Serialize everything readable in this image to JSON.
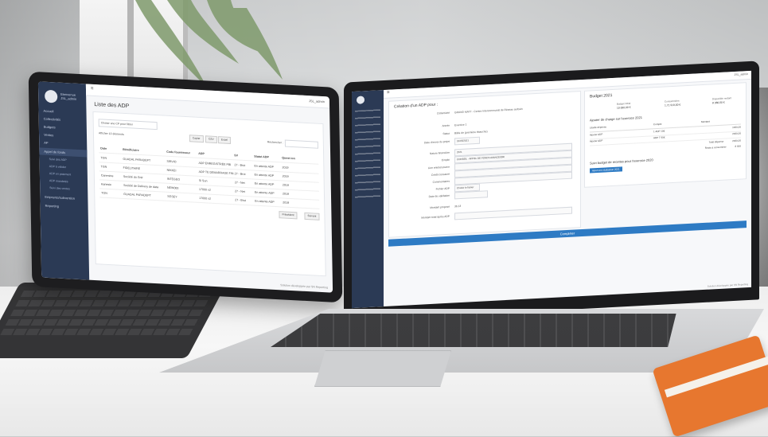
{
  "tablet": {
    "sidebar": {
      "user": "Bienvenue\nJSL_admin",
      "items": [
        "Accueil",
        "Collectivités",
        "Budgets",
        "Ventes",
        "AP",
        "Appel de fonds",
        "Suivi des ADP",
        "ADP à valider",
        "ADP en paiement",
        "ADP mandatés",
        "Suivi des ventes",
        "Emprunts/subvention",
        "Reporting"
      ]
    },
    "user_menu": "JSL_admin",
    "page_title": "Liste des ADP",
    "filter_placeholder": "Choisir une CP pour filtrer",
    "export_buttons": [
      "Copier",
      "CSV",
      "Excel"
    ],
    "search_label": "Rechercher :",
    "show_entries": "Afficher 10 éléments",
    "columns": [
      "Date",
      "Bénéficiaire",
      "Code fournisseur",
      "ADP",
      "SV",
      "Statut ADP",
      "Quest ion"
    ],
    "rows": [
      [
        "TGN",
        "GUADAL PARADEPT",
        "SIRVIO",
        "ADP ENREGISTRÉE PBI",
        "27 - Brut",
        "En attente ADP",
        "2019"
      ],
      [
        "TGN",
        "FIDELITAIRE",
        "NIKKEI",
        "ADP TE DEMARRAGE FIN",
        "27 - Brut",
        "En attente ADP",
        "2019"
      ],
      [
        "Caremine",
        "Société du Gnir",
        "INTEGEO",
        "Si Sun",
        "27 - Net",
        "En attente ADP",
        "2019"
      ],
      [
        "Kanesie",
        "Société de Delivery de data",
        "NEW000",
        "17000 x2",
        "27 - Net",
        "En attente ADP",
        "2019"
      ],
      [
        "TGN",
        "GUADAL PARADEPT",
        "SGSEY",
        "17000 x2",
        "27 - Brut",
        "En attente ADP",
        "2019"
      ]
    ],
    "pagination": [
      "Précédent",
      "Suivant"
    ],
    "footer": "Solution développée par SN Reporting"
  },
  "laptop": {
    "user_menu": "JSL_admin",
    "form_title": "Création d'un ADP pour :",
    "fields": [
      {
        "label": "Collectivité",
        "value": "GRAND MATT - Centre Intercommunal de Réseau surbain"
      },
      {
        "label": "Année",
        "value": "Exercice 1"
      },
      {
        "label": "Statut",
        "value": "Bâtis de (première ébauche)"
      },
      {
        "label": "Date d'envoi du projet",
        "value": "01/05/2021"
      },
      {
        "label": "Nature financière",
        "value": "2021"
      },
      {
        "label": "Emploi",
        "value": "CONSEIL - APPEL DE FONDS AVANCE/ORI"
      },
      {
        "label": "Lien entrée/source",
        "value": ""
      },
      {
        "label": "Crédit consacré",
        "value": ""
      },
      {
        "label": "Commentaires",
        "value": ""
      },
      {
        "label": "Fichier ADP",
        "value": "Choisir le fichier"
      },
      {
        "label": "Date de validation",
        "value": ""
      },
      {
        "label": "Montant proposé",
        "value": "36.13"
      },
      {
        "label": "Montant total après ADP",
        "value": ""
      }
    ],
    "submit": "Compléter",
    "budget_title": "Budget 2021",
    "budget_stats": [
      {
        "label": "Budget initial",
        "value": "10 000,00 €"
      },
      {
        "label": "Consommées",
        "value": "1,71 919,00 €"
      },
      {
        "label": "Disponible restant",
        "value": "8 380,00 €"
      }
    ],
    "tables_title": "Ajouter de charge sur l'exercice 2021",
    "table_headers": [
      "Libellé dépense",
      "Compte",
      "Montant"
    ],
    "table_rows": [
      [
        "Ajouter ADP",
        "1 ADP 10€",
        "1000,00"
      ],
      [
        "Ajouter ADP",
        "ADP T 60€",
        "2000,00"
      ]
    ],
    "totals": [
      {
        "label": "Total dépense",
        "value": "2000,00"
      },
      {
        "label": "Reste à consommer",
        "value": "8 000"
      }
    ],
    "recettes_title": "Suivi budget de recettes pour l'exercice 2020",
    "recettes_button": "Ajout une réalisation 2021",
    "footer": "Solution développée par SN Reporting"
  },
  "colors": {
    "sidebar": "#2b3a55",
    "accent": "#2e7bc4",
    "notebook": "#e7772f"
  }
}
